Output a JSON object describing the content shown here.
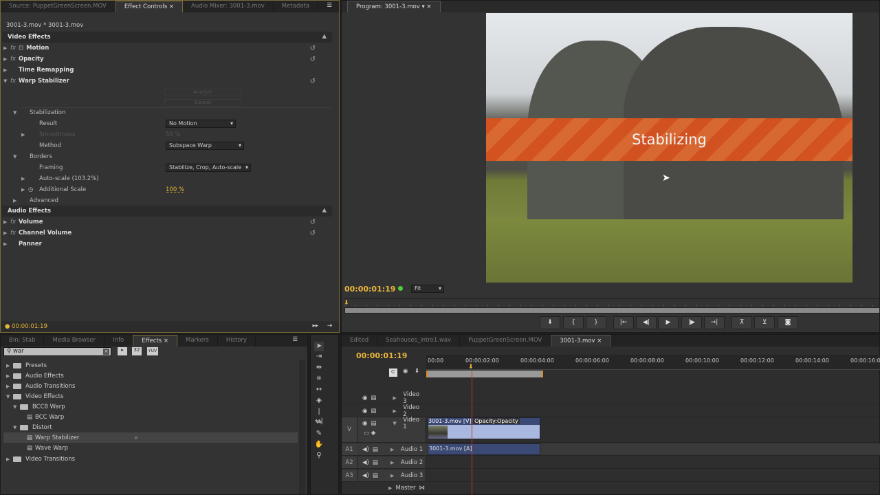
{
  "top_left_tabs": [
    "Source: PuppetGreenScreen.MOV",
    "Effect Controls",
    "Audio Mixer: 3001-3.mov",
    "Metadata"
  ],
  "effect_controls": {
    "clip_header": "3001-3.mov * 3001-3.mov",
    "video_effects_label": "Video Effects",
    "motion": "Motion",
    "opacity": "Opacity",
    "time_remapping": "Time Remapping",
    "warp_stabilizer": "Warp Stabilizer",
    "analyze": "Analyze",
    "cancel": "Cancel",
    "stabilization": "Stabilization",
    "result_label": "Result",
    "result_value": "No Motion",
    "smoothness_label": "Smoothness",
    "smoothness_value": "50 %",
    "method_label": "Method",
    "method_value": "Subspace Warp",
    "borders": "Borders",
    "framing_label": "Framing",
    "framing_value": "Stabilize, Crop, Auto-scale",
    "autoscale": "Auto-scale (103.2%)",
    "additional_scale_label": "Additional Scale",
    "additional_scale_value": "100 %",
    "advanced": "Advanced",
    "audio_effects_label": "Audio Effects",
    "volume": "Volume",
    "channel_volume": "Channel Volume",
    "panner": "Panner",
    "timecode": "00:00:01:19"
  },
  "program": {
    "tab": "Program: 3001-3.mov",
    "overlay_text": "Stabilizing",
    "timecode": "00:00:01:19",
    "zoom": "Fit",
    "banner_color": "#d9531e"
  },
  "bottom_left_tabs": [
    "Bin: Stab",
    "Media Browser",
    "Info",
    "Effects",
    "Markers",
    "History"
  ],
  "effects_panel": {
    "search_value": "war",
    "badges": [
      "32",
      "YUV"
    ],
    "tree": [
      {
        "label": "Presets",
        "level": 0
      },
      {
        "label": "Audio Effects",
        "level": 0
      },
      {
        "label": "Audio Transitions",
        "level": 0
      },
      {
        "label": "Video Effects",
        "level": 0,
        "open": true
      },
      {
        "label": "BCC8 Warp",
        "level": 1,
        "open": true
      },
      {
        "label": "BCC Warp",
        "level": 2
      },
      {
        "label": "Distort",
        "level": 1,
        "open": true
      },
      {
        "label": "Warp Stabilizer",
        "level": 2,
        "selected": true
      },
      {
        "label": "Wave Warp",
        "level": 2
      },
      {
        "label": "Video Transitions",
        "level": 0
      }
    ]
  },
  "timeline": {
    "tabs": [
      "Edited",
      "Seahouses_intro1.wav",
      "PuppetGreenScreen.MOV",
      "3001-3.mov"
    ],
    "timecode": "00:00:01:19",
    "ruler": [
      "00:00",
      "00:00:02:00",
      "00:00:04:00",
      "00:00:06:00",
      "00:00:08:00",
      "00:00:10:00",
      "00:00:12:00",
      "00:00:14:00",
      "00:00:16:00"
    ],
    "tracks": [
      {
        "label": "Video 3",
        "tag": ""
      },
      {
        "label": "Video 2",
        "tag": ""
      },
      {
        "label": "Video 1",
        "tag": "V"
      },
      {
        "label": "Audio 1",
        "tag": "A1"
      },
      {
        "label": "Audio 2",
        "tag": "A2"
      },
      {
        "label": "Audio 3",
        "tag": "A3"
      },
      {
        "label": "Master",
        "tag": ""
      }
    ],
    "video_clip": "3001-3.mov [V]",
    "video_clip_fx": "Opacity:Opacity",
    "audio_clip": "3001-3.mov [A]",
    "playhead_color": "#c0392b"
  }
}
